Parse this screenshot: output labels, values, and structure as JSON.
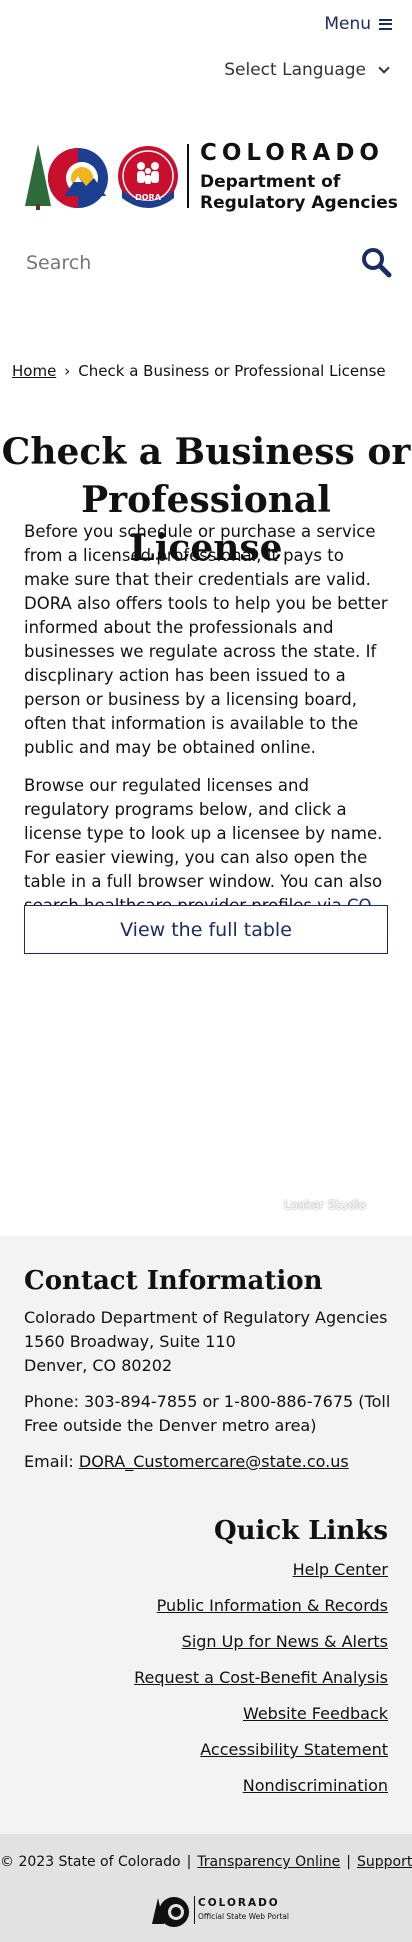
{
  "header": {
    "menu_label": "Menu",
    "language_select": "Select Language"
  },
  "logo": {
    "state": "COLORADO",
    "agency_line1": "Department of",
    "agency_line2": "Regulatory Agencies",
    "badge": "DORA"
  },
  "search": {
    "placeholder": "Search"
  },
  "breadcrumb": {
    "home": "Home",
    "separator": "›",
    "current": "Check a Business or Professional License"
  },
  "main": {
    "title_line1": "Check a Business or",
    "title_line2": "Professional License",
    "paragraph1": "Before you schedule or purchase a service from a licensed professional, it pays to make sure that their credentials are valid. DORA also offers tools to help you be better informed about the professionals and businesses we regulate across the state. If discplinary action has been issued to a person or business by a licensing board, often that information is available to the public and may be obtained online.",
    "paragraph2_text": "Browse our regulated licenses and regulatory programs below, and click a license type to look up a licensee by name. For easier viewing, you can also open the table in a full browser window. You can also search healthcare provider profiles via ",
    "paragraph2_link": "CO Health Professional Check",
    "paragraph2_end": ".",
    "view_table_button": "View the full table",
    "embed_badge": "Looker Studio"
  },
  "footer": {
    "contact_title": "Contact Information",
    "address_line1": "Colorado Department of Regulatory Agencies",
    "address_line2": "1560 Broadway, Suite 110",
    "address_line3": "Denver, CO 80202",
    "phone": "Phone: 303-894-7855 or 1-800-886-7675 (Toll Free outside the Denver metro area)",
    "email_label": "Email: ",
    "email": "DORA_Customercare@state.co.us",
    "quick_links_title": "Quick Links",
    "quick_links": [
      "Help Center",
      "Public Information & Records",
      "Sign Up for News & Alerts",
      "Request a Cost-Benefit Analysis",
      "Website Feedback",
      "Accessibility Statement",
      "Nondiscrimination"
    ]
  },
  "bottom": {
    "copyright": "© 2023 State of Colorado",
    "transparency": "Transparency Online",
    "support": "Support",
    "portal_name": "COLORADO",
    "portal_sub": "Official State Web Portal"
  },
  "colors": {
    "brand_navy": "#1b2b63",
    "logo_red": "#c8102e",
    "logo_blue": "#1d3f8f",
    "logo_gold": "#f2b51c",
    "logo_green": "#2e6b3a",
    "footer_bg": "#f3f3f3",
    "bottom_bg": "#e2e2e2"
  }
}
